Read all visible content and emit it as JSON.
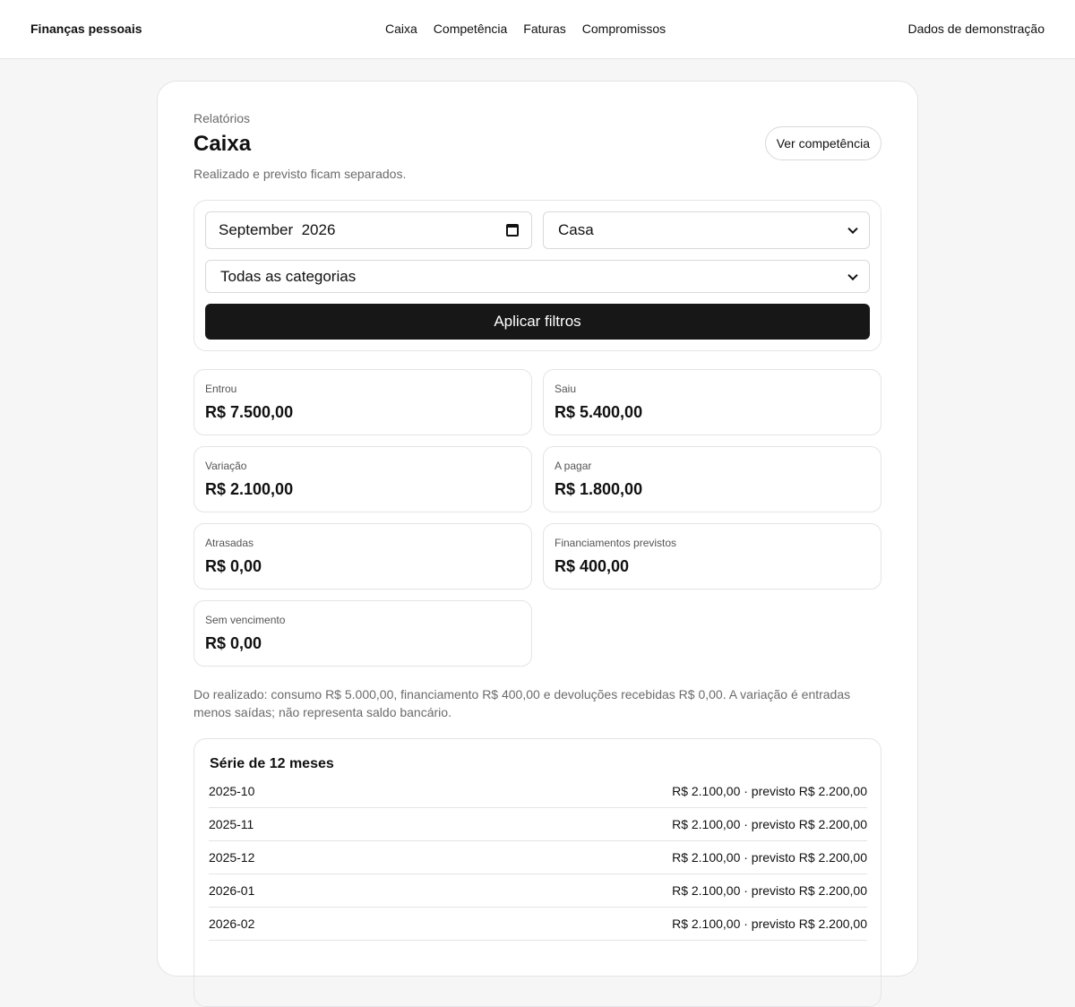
{
  "header": {
    "brand": "Finanças pessoais",
    "nav": [
      {
        "label": "Caixa"
      },
      {
        "label": "Competência"
      },
      {
        "label": "Faturas"
      },
      {
        "label": "Compromissos"
      }
    ],
    "demo_label": "Dados de demonstração"
  },
  "page": {
    "eyebrow": "Relatórios",
    "title": "Caixa",
    "subtitle": "Realizado e previsto ficam separados.",
    "ver_button": "Ver competência"
  },
  "filters": {
    "month_value": "September  2026",
    "household_value": "Casa",
    "category_value": "Todas as categorias",
    "apply_label": "Aplicar filtros"
  },
  "metrics": [
    {
      "label": "Entrou",
      "value": "R$ 7.500,00"
    },
    {
      "label": "Saiu",
      "value": "R$ 5.400,00"
    },
    {
      "label": "Variação",
      "value": "R$ 2.100,00"
    },
    {
      "label": "A pagar",
      "value": "R$ 1.800,00"
    },
    {
      "label": "Atrasadas",
      "value": "R$ 0,00"
    },
    {
      "label": "Financiamentos previstos",
      "value": "R$ 400,00"
    },
    {
      "label": "Sem vencimento",
      "value": "R$ 0,00"
    }
  ],
  "note": "Do realizado: consumo R$ 5.000,00, financiamento R$ 400,00 e devoluções recebidas R$ 0,00. A variação é entradas menos saídas; não representa saldo bancário.",
  "series": {
    "title": "Série de 12 meses",
    "rows": [
      {
        "month": "2025-10",
        "value": "R$ 2.100,00 · previsto R$ 2.200,00"
      },
      {
        "month": "2025-11",
        "value": "R$ 2.100,00 · previsto R$ 2.200,00"
      },
      {
        "month": "2025-12",
        "value": "R$ 2.100,00 · previsto R$ 2.200,00"
      },
      {
        "month": "2026-01",
        "value": "R$ 2.100,00 · previsto R$ 2.200,00"
      },
      {
        "month": "2026-02",
        "value": "R$ 2.100,00 · previsto R$ 2.200,00"
      }
    ]
  }
}
